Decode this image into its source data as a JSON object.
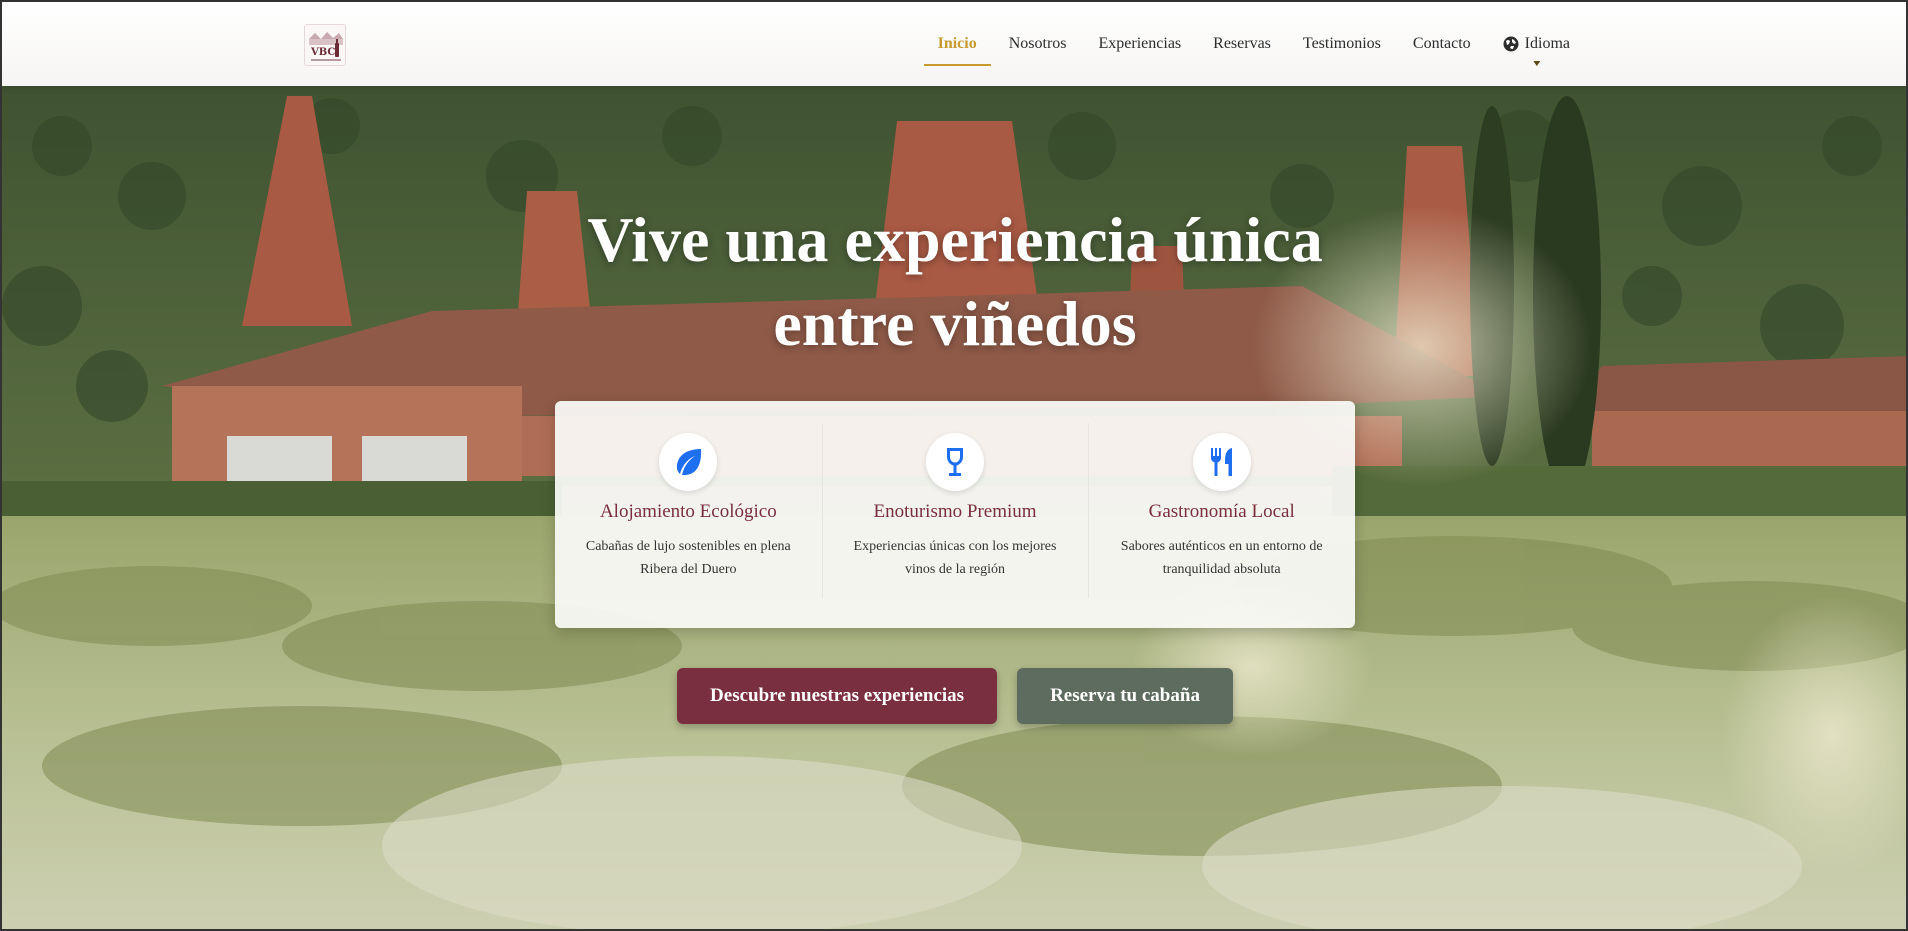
{
  "nav": {
    "logo_alt": "VBC",
    "items": [
      {
        "label": "Inicio",
        "active": true
      },
      {
        "label": "Nosotros"
      },
      {
        "label": "Experiencias"
      },
      {
        "label": "Reservas"
      },
      {
        "label": "Testimonios"
      },
      {
        "label": "Contacto"
      }
    ],
    "language": {
      "label": "Idioma",
      "icon": "globe-icon"
    }
  },
  "hero": {
    "headline_line1": "Vive una experiencia única",
    "headline_line2": "entre viñedos",
    "features": [
      {
        "icon": "leaf-icon",
        "title": "Alojamiento Ecológico",
        "description": "Cabañas de lujo sostenibles en plena Ribera del Duero"
      },
      {
        "icon": "wine-glass-icon",
        "title": "Enoturismo Premium",
        "description": "Experiencias únicas con los mejores vinos de la región"
      },
      {
        "icon": "utensils-icon",
        "title": "Gastronomía Local",
        "description": "Sabores auténticos en un entorno de tranquilidad absoluta"
      }
    ],
    "cta_primary": "Descubre nuestras experiencias",
    "cta_secondary": "Reserva tu cabaña"
  },
  "colors": {
    "accent_gold": "#c69a2c",
    "wine": "#7a2f40",
    "sage": "#5e6b5f",
    "icon_blue": "#1e6ef0"
  }
}
